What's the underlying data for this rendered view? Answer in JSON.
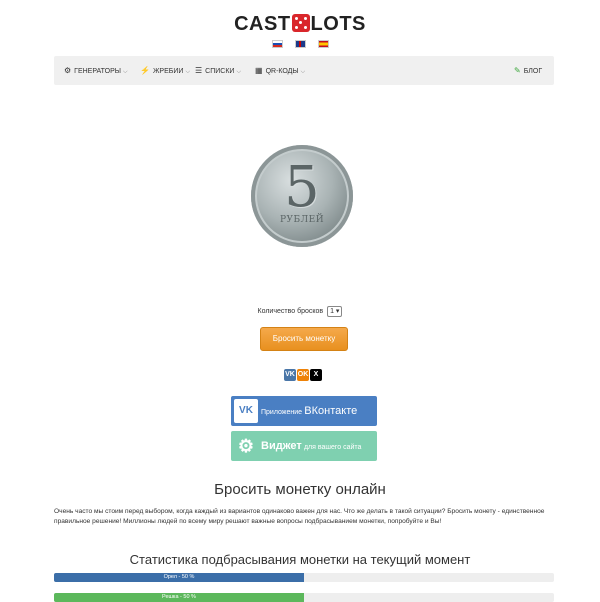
{
  "logo": {
    "part1": "CAST",
    "part2": "LOTS"
  },
  "nav": {
    "items": [
      {
        "label": "ГЕНЕРАТОРЫ"
      },
      {
        "label": "ЖРЕБИИ"
      },
      {
        "label": "СПИСКИ"
      },
      {
        "label": "QR-КОДЫ"
      }
    ],
    "blog": "БЛОГ"
  },
  "coin": {
    "denomination": "5",
    "text": "РУБЛЕЙ"
  },
  "controls": {
    "count_label": "Количество бросков",
    "count_value": "1",
    "toss_button": "Бросить монетку"
  },
  "share": {
    "vk": "VK",
    "ok": "OK",
    "x": "X"
  },
  "banners": {
    "vk": {
      "prefix": "Приложение",
      "main": "ВКонтакте"
    },
    "widget": {
      "main": "Виджет",
      "suffix": "для вашего сайта"
    }
  },
  "content": {
    "title": "Бросить монетку онлайн",
    "paragraph": "Очень часто мы стоим перед выбором, когда каждый из вариантов одинаково важен для нас. Что же делать в такой ситуации? Бросить монету - единственное правильное решение! Миллионы людей по всему миру решают важные вопросы подбрасыванием монетки, попробуйте и Вы!",
    "stats_title": "Статистика подбрасывания монетки на текущий момент"
  },
  "stats": [
    {
      "label": "Орел - 50 %",
      "percent": 50,
      "color": "#3b6ea8"
    },
    {
      "label": "Решка - 50 %",
      "percent": 50,
      "color": "#5cb85c"
    }
  ]
}
